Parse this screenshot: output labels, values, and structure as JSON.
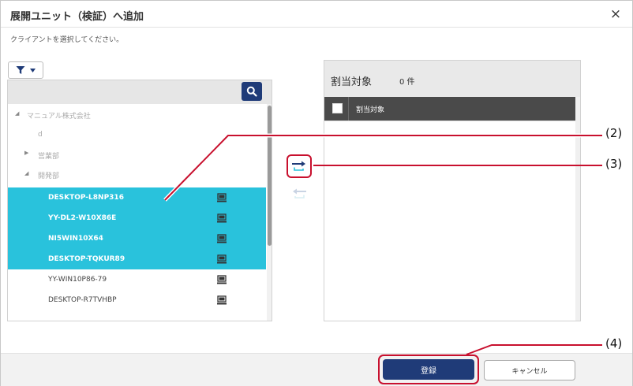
{
  "dialog": {
    "title": "展開ユニット（検証）へ追加",
    "close_symbol": "×",
    "instruction": "クライアントを選択してください。"
  },
  "filter": {
    "icon": "filter-icon",
    "caret": "▼"
  },
  "search": {
    "icon": "search-icon"
  },
  "tree": {
    "root": "マニュアル株式会社",
    "d_label": "d",
    "sales": "営業部",
    "dev": "開発部"
  },
  "clients": [
    {
      "name": "DESKTOP-L8NP316",
      "selected": true,
      "icon": "pc-icon"
    },
    {
      "name": "YY-DL2-W10X86E",
      "selected": true,
      "icon": "pc-icon"
    },
    {
      "name": "NI5WIN10X64",
      "selected": true,
      "icon": "pc-icon"
    },
    {
      "name": "DESKTOP-TQKUR89",
      "selected": true,
      "icon": "pc-icon"
    },
    {
      "name": "YY-WIN10P86-79",
      "selected": false,
      "icon": "pc-icon"
    },
    {
      "name": "DESKTOP-R7TVHBP",
      "selected": false,
      "icon": "pc-icon"
    }
  ],
  "assigned": {
    "title": "割当対象",
    "count": "0 件",
    "column": "割当対象"
  },
  "buttons": {
    "register": "登録",
    "cancel": "キャンセル"
  },
  "callouts": [
    "(2)",
    "(3)",
    "(4)"
  ],
  "colors": {
    "selected_row": "#29c2dc",
    "primary": "#1f3b78",
    "highlight": "#c8102e"
  }
}
